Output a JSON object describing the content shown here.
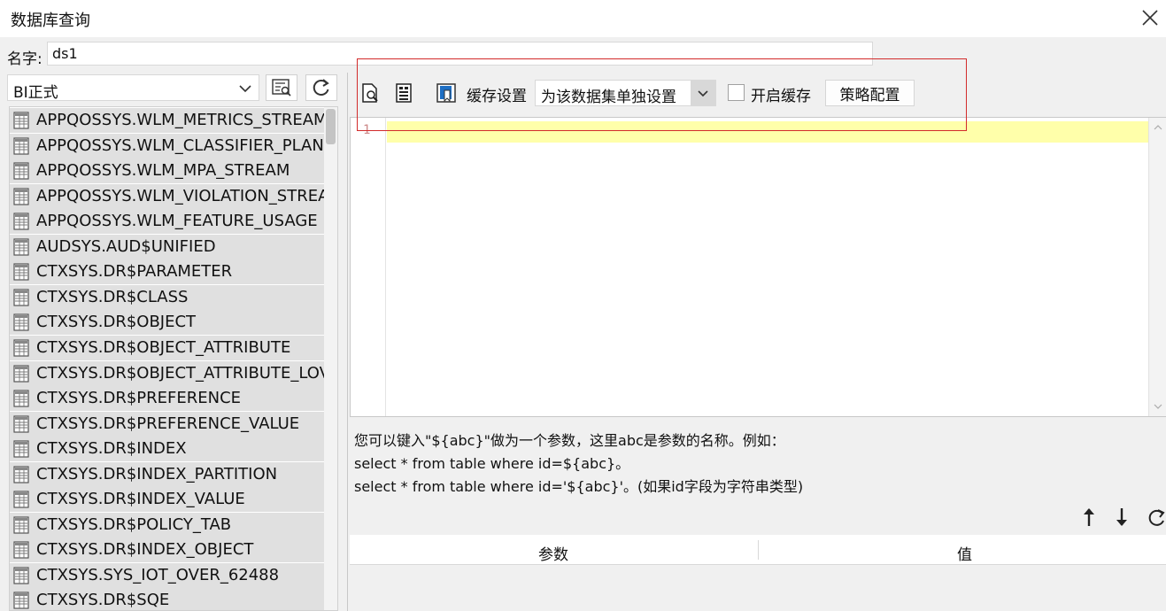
{
  "window": {
    "title": "数据库查询"
  },
  "name_field": {
    "label": "名字:",
    "value": "ds1"
  },
  "datasource": {
    "selected": "BI正式"
  },
  "tables": [
    "APPQOSSYS.WLM_METRICS_STREAM",
    "APPQOSSYS.WLM_CLASSIFIER_PLAN",
    "APPQOSSYS.WLM_MPA_STREAM",
    "APPQOSSYS.WLM_VIOLATION_STREA",
    "APPQOSSYS.WLM_FEATURE_USAGE",
    "AUDSYS.AUD$UNIFIED",
    "CTXSYS.DR$PARAMETER",
    "CTXSYS.DR$CLASS",
    "CTXSYS.DR$OBJECT",
    "CTXSYS.DR$OBJECT_ATTRIBUTE",
    "CTXSYS.DR$OBJECT_ATTRIBUTE_LOV",
    "CTXSYS.DR$PREFERENCE",
    "CTXSYS.DR$PREFERENCE_VALUE",
    "CTXSYS.DR$INDEX",
    "CTXSYS.DR$INDEX_PARTITION",
    "CTXSYS.DR$INDEX_VALUE",
    "CTXSYS.DR$POLICY_TAB",
    "CTXSYS.DR$INDEX_OBJECT",
    "CTXSYS.SYS_IOT_OVER_62488",
    "CTXSYS.DR$SQE"
  ],
  "toolbar": {
    "cache_label": "缓存设置",
    "cache_mode": "为该数据集单独设置",
    "enable_cache_label": "开启缓存",
    "enable_cache_checked": false,
    "strategy_button": "策略配置"
  },
  "editor": {
    "line_number": "1",
    "content": ""
  },
  "hint": {
    "line1": "您可以键入\"${abc}\"做为一个参数，这里abc是参数的名称。例如：",
    "line2": "select * from table where id=${abc}。",
    "line3": "select * from table where id='${abc}'。(如果id字段为字符串类型)"
  },
  "params": {
    "col_param": "参数",
    "col_value": "值",
    "rows": []
  },
  "colors": {
    "highlight_border": "#d22b2b",
    "current_line": "#ffffaa",
    "list_row": "#e0e0e0"
  }
}
